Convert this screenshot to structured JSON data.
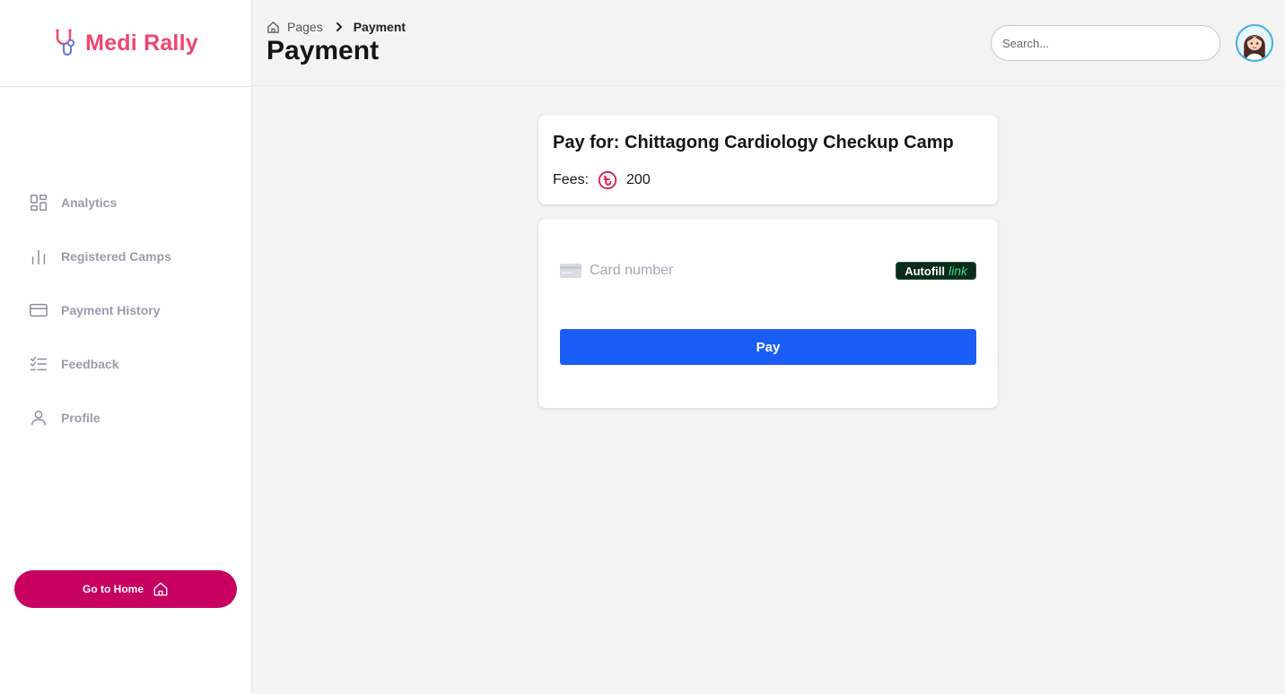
{
  "brand": {
    "name": "Medi Rally",
    "color": "#f0456e",
    "icon": "stethoscope-icon"
  },
  "sidebar": {
    "items": [
      {
        "label": "Analytics",
        "icon": "dashboard-grid-icon"
      },
      {
        "label": "Registered Camps",
        "icon": "bar-chart-icon"
      },
      {
        "label": "Payment History",
        "icon": "credit-card-icon"
      },
      {
        "label": "Feedback",
        "icon": "checklist-icon"
      },
      {
        "label": "Profile",
        "icon": "user-icon"
      }
    ],
    "home_button": {
      "label": "Go to Home",
      "icon": "home-icon",
      "color": "#c80060"
    }
  },
  "header": {
    "breadcrumb": {
      "root": "Pages",
      "current": "Payment"
    },
    "title": "Payment",
    "search": {
      "placeholder": "Search...",
      "value": ""
    },
    "avatar": "user-avatar"
  },
  "payment": {
    "title": "Pay for: Chittagong Cardiology Checkup Camp",
    "fees_label": "Fees:",
    "currency_icon": "taka-icon",
    "fees_value": "200",
    "card_placeholder": "Card number",
    "autofill_label": "Autofill",
    "autofill_link": "link",
    "pay_label": "Pay",
    "pay_color": "#1a5ef7"
  }
}
